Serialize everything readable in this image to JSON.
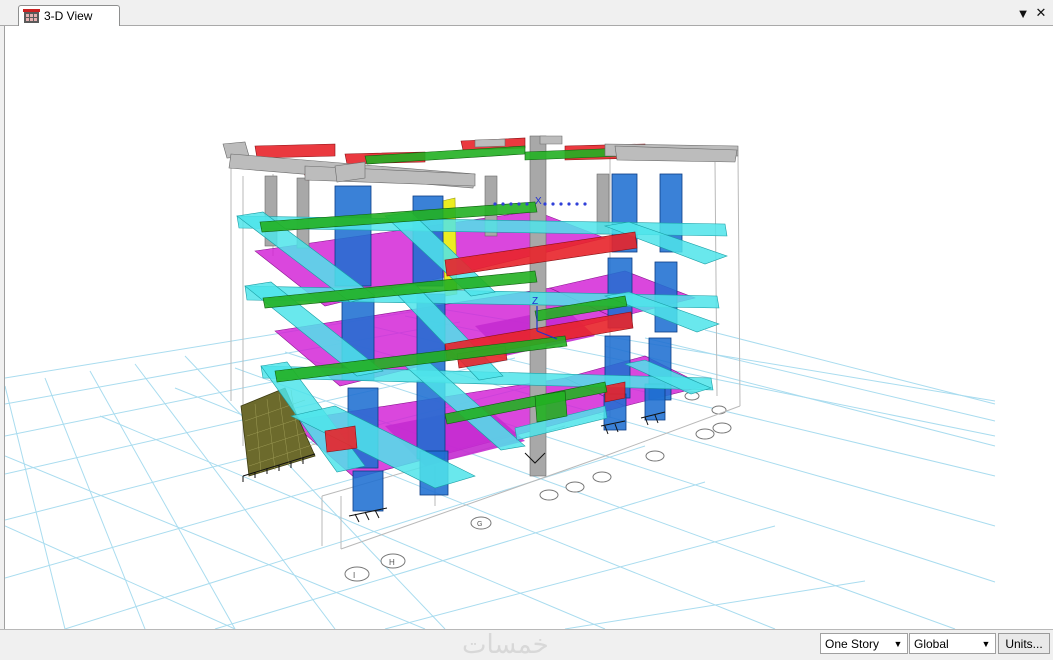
{
  "tab": {
    "label": "3-D View",
    "icon": "3d-view-icon"
  },
  "window_controls": {
    "dropdown_glyph": "▼",
    "close_glyph": "✕"
  },
  "model": {
    "axis_label_z": "Z",
    "axis_label_x": "X",
    "grid_bubbles": [
      "I",
      "H",
      "G"
    ],
    "colors": {
      "column": "#1f6fd1",
      "column_light": "#7fb0e8",
      "beam_cyan": "#4fe4ea",
      "beam_red": "#e8242a",
      "beam_green": "#22b022",
      "beam_gray": "#a8a8a8",
      "slab_magenta": "#d21fd6",
      "wall_olive": "#6c6a2c",
      "brace_yellow": "#ecec22",
      "grid": "#a9dcef"
    }
  },
  "status": {
    "watermark": "خمسات",
    "story_select": "One Story",
    "coord_select": "Global",
    "units_button": "Units..."
  }
}
